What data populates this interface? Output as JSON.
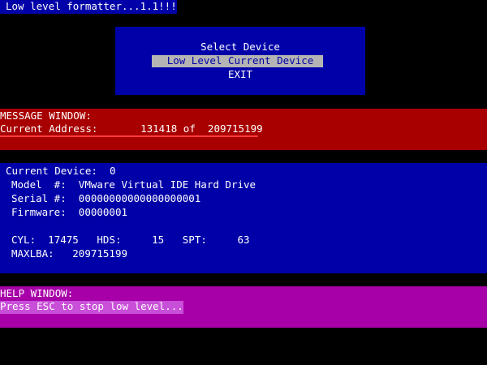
{
  "title": "Low level formatter...1.1!!!",
  "menu": {
    "header": "Select Device",
    "items": [
      {
        "label": "Low Level Current Device",
        "selected": true
      },
      {
        "label": "EXIT",
        "selected": false
      }
    ]
  },
  "message_window": {
    "title": "MESSAGE WINDOW:",
    "current_address_label": "Current Address:",
    "current_address": "131418",
    "of_label": "of",
    "total": "209715199"
  },
  "device": {
    "current_device_label": "Current Device:",
    "current_device": "0",
    "model_label": "Model  #:",
    "model": "VMware Virtual IDE Hard Drive",
    "serial_label": "Serial #:",
    "serial": "00000000000000000001",
    "firmware_label": "Firmware:",
    "firmware": "00000001",
    "cyl_label": "CYL:",
    "cyl": "17475",
    "hds_label": "HDS:",
    "hds": "15",
    "spt_label": "SPT:",
    "spt": "63",
    "maxlba_label": "MAXLBA:",
    "maxlba": "209715199"
  },
  "help_window": {
    "title": "HELP WINDOW:",
    "message": "Press ESC to stop low level..."
  },
  "colors": {
    "background": "#000000",
    "menu_blue": "#0000a8",
    "message_red": "#a80000",
    "help_magenta": "#a800a8",
    "highlight_gray": "#b4b4b4"
  }
}
